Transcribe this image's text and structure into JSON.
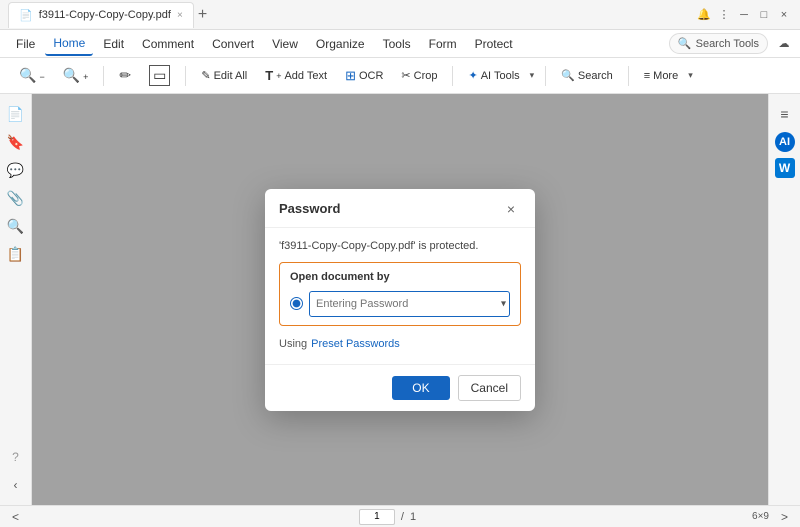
{
  "titlebar": {
    "tab_label": "f3911-Copy-Copy-Copy.pdf",
    "new_tab_label": "+"
  },
  "menu": {
    "items": [
      "File",
      "Home",
      "Edit",
      "Comment",
      "Convert",
      "View",
      "Organize",
      "Tools",
      "Form",
      "Protect"
    ],
    "active": "Home",
    "search_placeholder": "Search Tools"
  },
  "toolbar": {
    "buttons": [
      {
        "label": "",
        "icon": "🔍-",
        "name": "zoom-out"
      },
      {
        "label": "",
        "icon": "🔍+",
        "name": "zoom-in"
      },
      {
        "label": "",
        "icon": "✏",
        "name": "highlight"
      },
      {
        "label": "",
        "icon": "▭",
        "name": "rectangle"
      },
      {
        "label": "Edit All",
        "icon": "✎",
        "name": "edit-all"
      },
      {
        "label": "Add Text",
        "icon": "T+",
        "name": "add-text"
      },
      {
        "label": "OCR",
        "icon": "⊞",
        "name": "ocr"
      },
      {
        "label": "Crop",
        "icon": "✂",
        "name": "crop"
      },
      {
        "label": "AI Tools",
        "icon": "✦",
        "name": "ai-tools"
      },
      {
        "label": "Search",
        "icon": "🔍",
        "name": "search"
      },
      {
        "label": "More",
        "icon": "≡",
        "name": "more"
      }
    ]
  },
  "sidebar_left": {
    "icons": [
      "📄",
      "🔖",
      "💬",
      "📎",
      "🔍",
      "📋"
    ]
  },
  "sidebar_right": {
    "icons": [
      {
        "label": "≡≡≡",
        "name": "panel-settings"
      },
      {
        "label": "AI",
        "name": "ai-button"
      },
      {
        "label": "W",
        "name": "word-button"
      }
    ]
  },
  "modal": {
    "title": "Password",
    "close_label": "×",
    "description": "'f3911-Copy-Copy-Copy.pdf' is protected.",
    "open_doc_label": "Open document by",
    "password_placeholder": "Entering Password",
    "using_label": "Using",
    "preset_label": "Preset Passwords",
    "ok_label": "OK",
    "cancel_label": "Cancel"
  },
  "bottom_bar": {
    "page_current": "1",
    "page_total": "1",
    "zoom": "6×9",
    "nav_prev": "<",
    "nav_next": ">"
  }
}
